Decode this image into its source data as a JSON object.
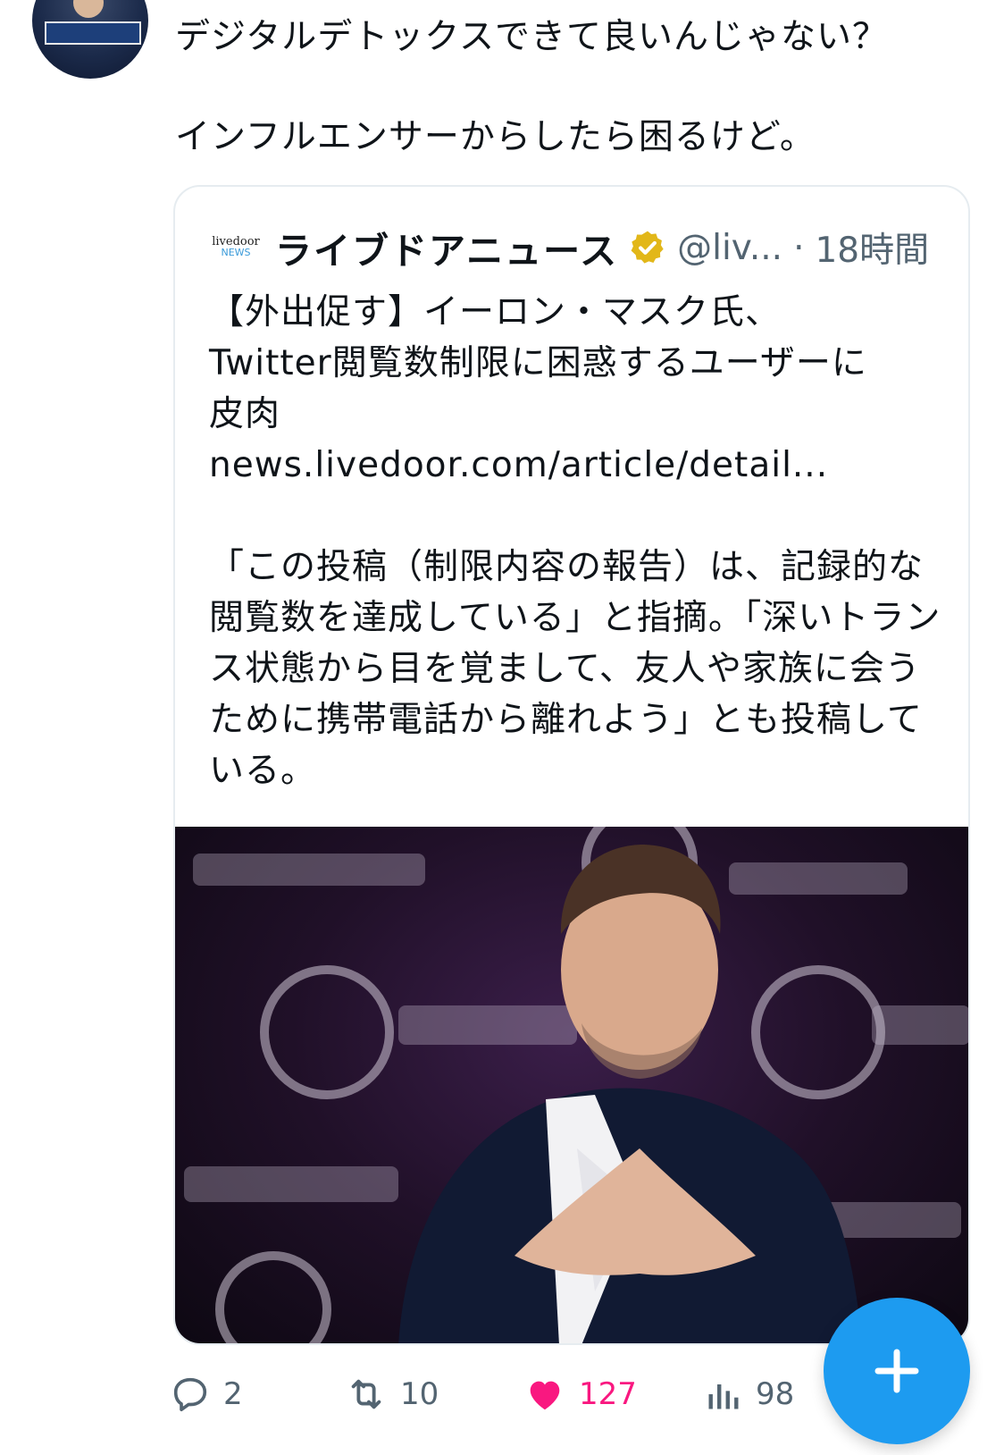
{
  "post": {
    "text_line1": "デジタルデトックスできて良いんじゃない？",
    "text_line2": "インフルエンサーからしたら困るけど。"
  },
  "quote": {
    "logo_line1": "livedoor",
    "logo_line2": "NEWS",
    "display_name": "ライブドアニュース",
    "handle": "@liv...",
    "separator": "·",
    "time": "18時間",
    "body_line1": "【外出促す】イーロン・マスク氏、",
    "body_line2": "Twitter閲覧数制限に困惑するユーザーに",
    "body_line3": "皮肉",
    "body_link": "news.livedoor.com/article/detail...",
    "body_para2": "「この投稿（制限内容の報告）は、記録的な閲覧数を達成している」と指摘。「深いトランス状態から目を覚まして、友人や家族に会うために携帯電話から離れよう」とも投稿している。"
  },
  "actions": {
    "replies": "2",
    "retweets": "10",
    "likes": "127",
    "views": "98"
  },
  "colors": {
    "accent": "#1d9bf0",
    "like": "#f91880",
    "verified": "#e2b719",
    "muted": "#536471"
  },
  "icons": {
    "reply": "reply-icon",
    "retweet": "retweet-icon",
    "like": "heart-icon",
    "views": "views-icon",
    "compose": "plus-icon",
    "verified": "verified-badge-icon"
  }
}
